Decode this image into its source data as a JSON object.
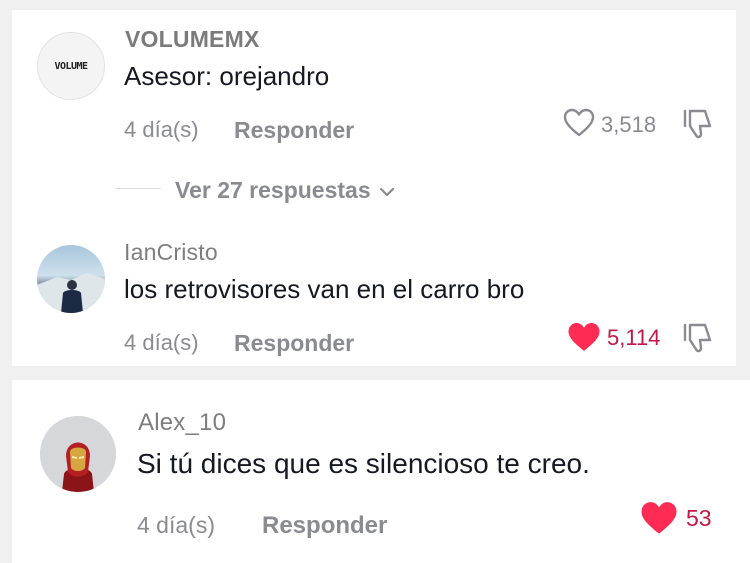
{
  "comments": [
    {
      "username": "VOLUMEMX",
      "avatar_text": "VOLUME",
      "text": "Asesor: orejandro",
      "time": "4 día(s)",
      "reply_label": "Responder",
      "likes": "3,518",
      "liked": false
    },
    {
      "username": "IanCristo",
      "text": "los retrovisores van en el carro bro",
      "time": "4 día(s)",
      "reply_label": "Responder",
      "likes": "5,114",
      "liked": true
    },
    {
      "username": "Alex_10",
      "text": "Si tú dices que es silencioso te creo.",
      "time": "4 día(s)",
      "reply_label": "Responder",
      "likes": "53",
      "liked": true
    }
  ],
  "view_replies_label": "Ver 27 respuestas",
  "colors": {
    "like_red": "#fe2c55",
    "like_count_red": "#c0194b",
    "muted_gray": "#8a8b91"
  }
}
